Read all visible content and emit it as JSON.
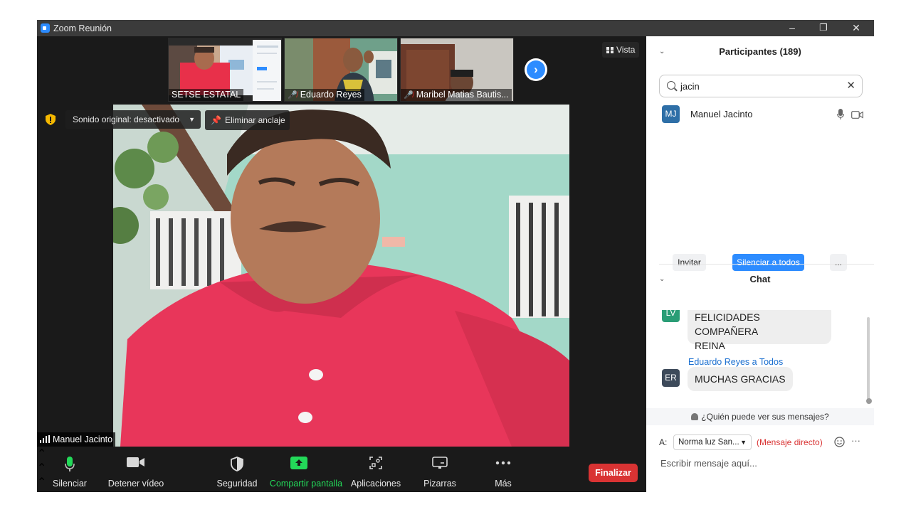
{
  "window": {
    "title": "Zoom Reunión",
    "minimize": "–",
    "restore": "❐",
    "close": "✕"
  },
  "gallery": [
    {
      "name": "SETSE ESTATAL",
      "muted": false
    },
    {
      "name": "Eduardo Reyes",
      "muted": true
    },
    {
      "name": "Maribel Matias Bautis...",
      "muted": true
    }
  ],
  "view_button": "Vista",
  "video": {
    "sound_option": "Sonido original: desactivado",
    "unpin_label": "Eliminar anclaje",
    "active_speaker": "Manuel Jacinto"
  },
  "toolbar": {
    "mute": "Silenciar",
    "stop_video": "Detener vídeo",
    "security": "Seguridad",
    "share": "Compartir pantalla",
    "apps": "Aplicaciones",
    "whiteboards": "Pizarras",
    "more": "Más",
    "end": "Finalizar"
  },
  "participants": {
    "header": "Participantes (189)",
    "search_value": "jacin",
    "results": [
      {
        "initials": "MJ",
        "name": "Manuel Jacinto"
      }
    ],
    "invite": "Invitar",
    "mute_all": "Silenciar a todos",
    "more": "..."
  },
  "chat": {
    "header": "Chat",
    "messages": [
      {
        "initials": "LV",
        "text_line1": "FELICIDADES COMPAÑERA",
        "text_line2": "REINA"
      },
      {
        "sender": "Eduardo Reyes a Todos",
        "initials": "ER",
        "text": "MUCHAS GRACIAS"
      }
    ],
    "who_sees": "¿Quién puede ver sus mensajes?",
    "to_label": "A:",
    "recipient": "Norma luz San...",
    "direct": "(Mensaje directo)",
    "placeholder": "Escribir mensaje aquí..."
  },
  "colors": {
    "zoom_blue": "#2d8cff",
    "end_red": "#d93333",
    "share_green": "#23d959",
    "mj_avatar": "#2e6fa7",
    "lv_avatar": "#2a9d76",
    "er_avatar": "#3d4a5a",
    "direct_red": "#d93333"
  }
}
